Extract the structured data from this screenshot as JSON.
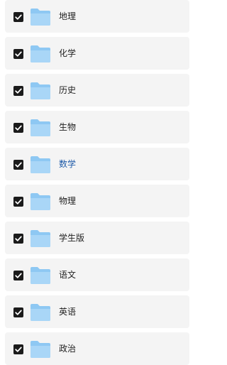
{
  "folders": [
    {
      "label": "地理",
      "checked": true,
      "icon": "folder-icon"
    },
    {
      "label": "化学",
      "checked": true,
      "icon": "folder-icon"
    },
    {
      "label": "历史",
      "checked": true,
      "icon": "folder-icon"
    },
    {
      "label": "生物",
      "checked": true,
      "icon": "folder-icon"
    },
    {
      "label": "数学",
      "checked": true,
      "icon": "folder-icon",
      "active": true
    },
    {
      "label": "物理",
      "checked": true,
      "icon": "folder-icon"
    },
    {
      "label": "学生版",
      "checked": true,
      "icon": "folder-icon"
    },
    {
      "label": "语文",
      "checked": true,
      "icon": "folder-icon"
    },
    {
      "label": "英语",
      "checked": true,
      "icon": "folder-icon"
    },
    {
      "label": "政治",
      "checked": true,
      "icon": "folder-icon"
    }
  ],
  "colors": {
    "row_background": "#f4f4f4",
    "checkbox": "#1b1b1b",
    "folder": "#8ec8f3",
    "active_label": "#1e5aa8",
    "label": "#222222"
  }
}
